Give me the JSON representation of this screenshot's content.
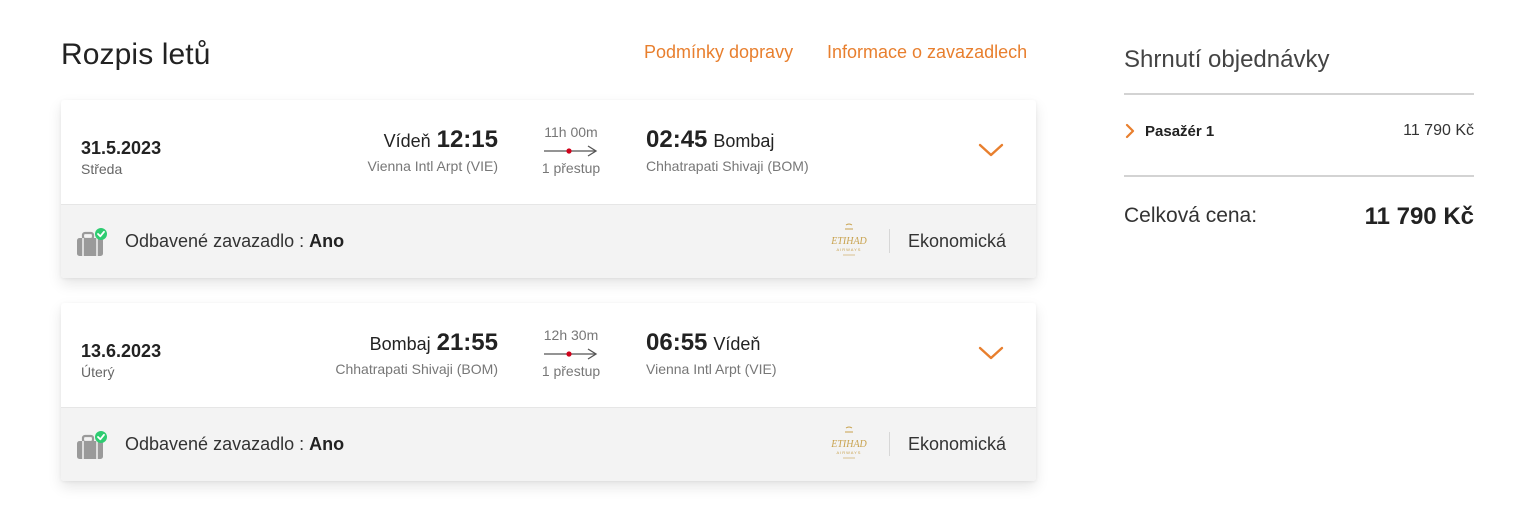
{
  "header": {
    "title": "Rozpis letů",
    "links": {
      "conditions": "Podmínky dopravy",
      "baggage": "Informace o zavazadlech"
    }
  },
  "flights": [
    {
      "date": "31.5.2023",
      "weekday": "Středa",
      "departure": {
        "city": "Vídeň",
        "time": "12:15",
        "airport": "Vienna Intl Arpt (VIE)"
      },
      "duration": "11h 00m",
      "stops": "1 přestup",
      "arrival": {
        "time": "02:45",
        "city": "Bombaj",
        "airport": "Chhatrapati Shivaji (BOM)"
      },
      "baggage_label": "Odbavené zavazadlo : ",
      "baggage_value": "Ano",
      "cabin": "Ekonomická",
      "airline_logo": "ETIHAD",
      "airline_logo_sub": "AIRWAYS"
    },
    {
      "date": "13.6.2023",
      "weekday": "Úterý",
      "departure": {
        "city": "Bombaj",
        "time": "21:55",
        "airport": "Chhatrapati Shivaji (BOM)"
      },
      "duration": "12h 30m",
      "stops": "1 přestup",
      "arrival": {
        "time": "06:55",
        "city": "Vídeň",
        "airport": "Vienna Intl Arpt (VIE)"
      },
      "baggage_label": "Odbavené zavazadlo : ",
      "baggage_value": "Ano",
      "cabin": "Ekonomická",
      "airline_logo": "ETIHAD",
      "airline_logo_sub": "AIRWAYS"
    }
  ],
  "summary": {
    "title": "Shrnutí objednávky",
    "passenger_label": "Pasažér 1",
    "passenger_price": "11 790 Kč",
    "total_label": "Celková cena:",
    "total_value": "11 790 Kč"
  },
  "colors": {
    "accent": "#e87f2e",
    "check": "#2ecc71",
    "stop_dot": "#d0021b",
    "logo_gold": "#c8a24e"
  },
  "icons": {
    "expand": "chevron-down-icon",
    "baggage": "suitcase-icon",
    "baggage_status": "check-circle-icon",
    "passenger_expand": "chevron-right-icon"
  }
}
